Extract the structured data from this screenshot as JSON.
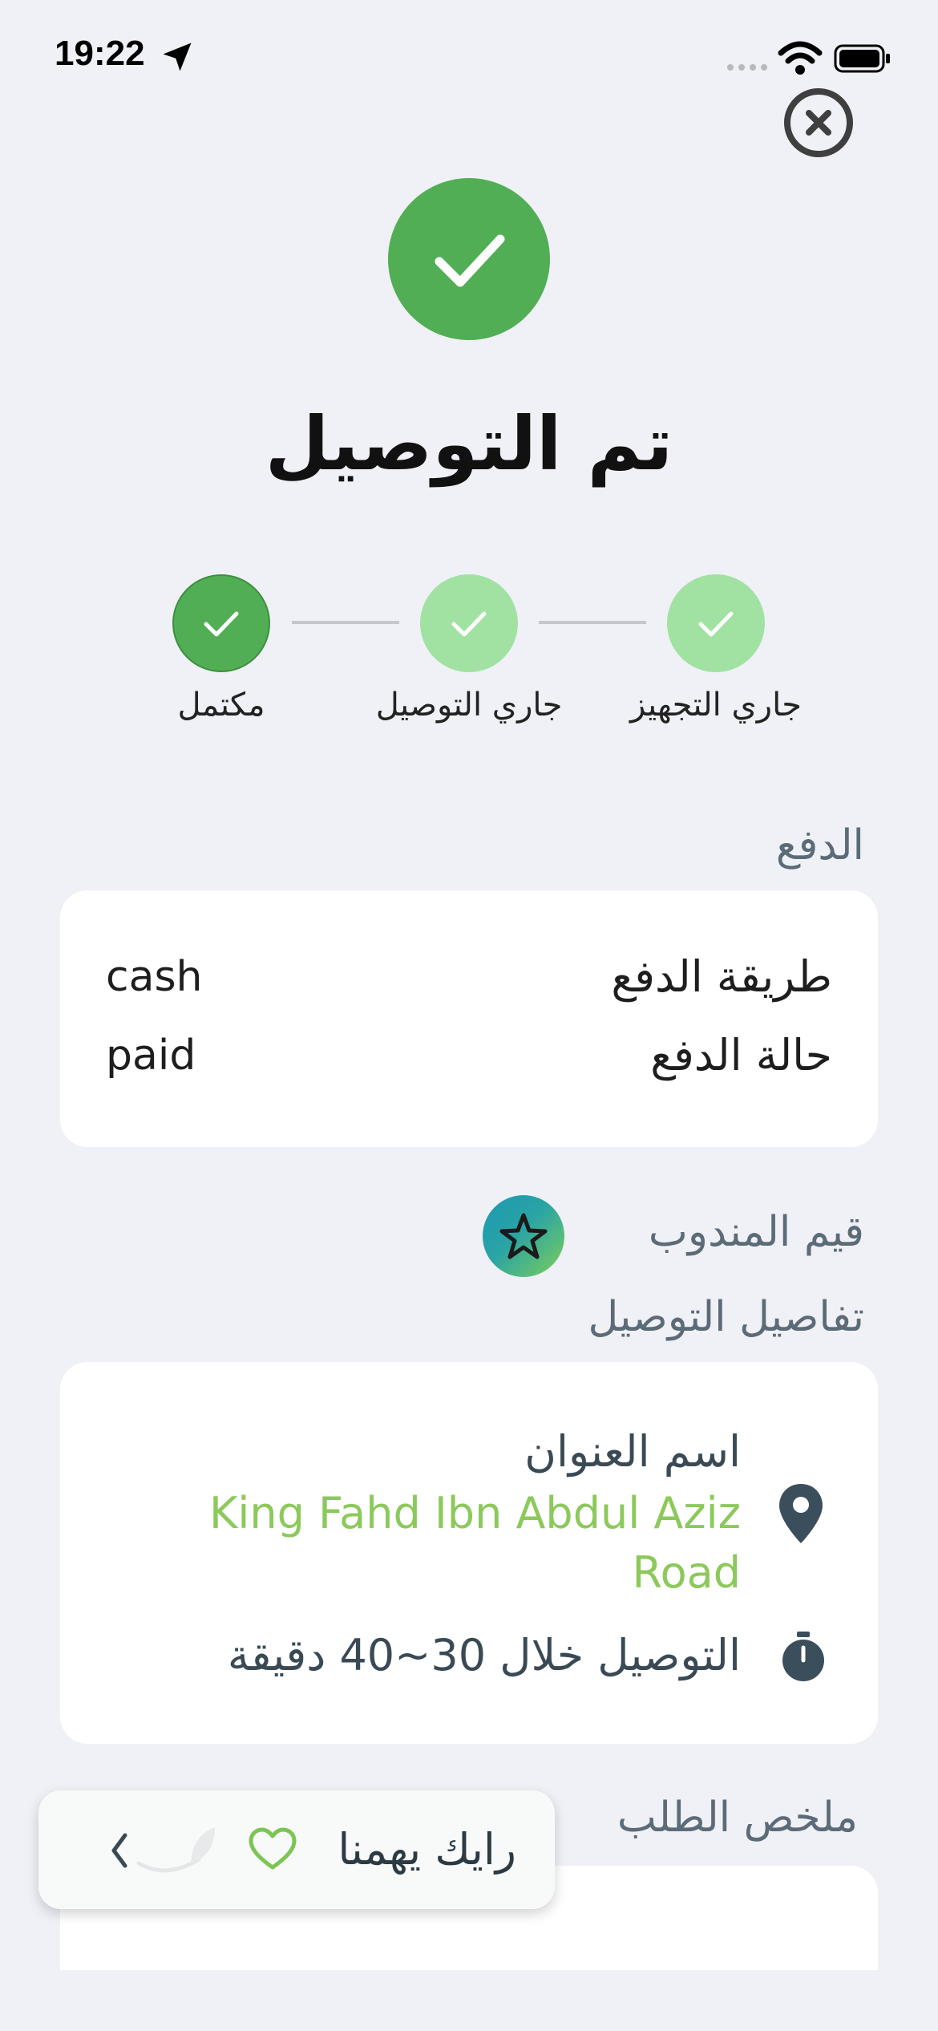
{
  "status_bar": {
    "time": "19:22"
  },
  "header": {
    "title": "تم التوصيل"
  },
  "stepper": {
    "steps": [
      {
        "label": "جاري التجهيز",
        "state": "done"
      },
      {
        "label": "جاري التوصيل",
        "state": "done"
      },
      {
        "label": "مكتمل",
        "state": "current"
      }
    ]
  },
  "payment": {
    "section_title": "الدفع",
    "method_label": "طريقة الدفع",
    "method_value": "cash",
    "status_label": "حالة الدفع",
    "status_value": "paid"
  },
  "rate_driver": {
    "label": "قيم المندوب"
  },
  "delivery": {
    "section_title": "تفاصيل التوصيل",
    "address_label": "اسم العنوان",
    "address_value": "King Fahd Ibn Abdul Aziz Road",
    "eta": "التوصيل خلال  30~40 دقيقة"
  },
  "order_summary": {
    "section_title": "ملخص الطلب"
  },
  "feedback": {
    "label": "رايك يهمنا"
  },
  "colors": {
    "primary_green": "#52ae54",
    "light_green": "#a1e2a2",
    "address_green": "#8cc95b",
    "background": "#eff1f6"
  }
}
